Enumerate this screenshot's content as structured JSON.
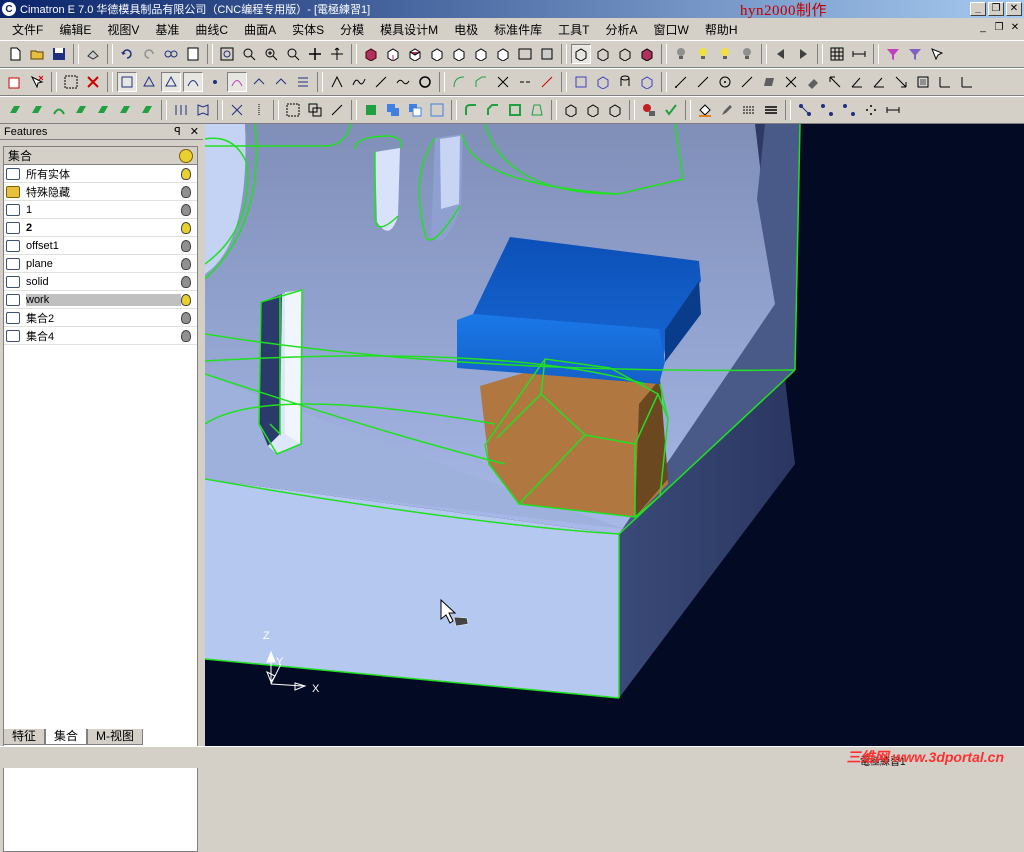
{
  "window": {
    "title": "Cimatron E 7.0  华德模具制品有限公司（CNC编程专用版）- [電極練習1]",
    "watermark": "hyn2000制作",
    "controls": [
      "_",
      "❐",
      "✕"
    ]
  },
  "menubar": {
    "items": [
      "文件F",
      "编辑E",
      "视图V",
      "基准",
      "曲线C",
      "曲面A",
      "实体S",
      "分模",
      "模具设计M",
      "电极",
      "标准件库",
      "工具T",
      "分析A",
      "窗口W",
      "帮助H"
    ],
    "mdi_controls": [
      "_",
      "❐",
      "✕"
    ]
  },
  "panel": {
    "title": "Features",
    "pin": "ꟼ",
    "close": "✕",
    "header": "集合",
    "rows": [
      {
        "label": "所有实体",
        "bulb": "#e8d030",
        "icon": "all"
      },
      {
        "label": "特殊隐藏",
        "bulb": "#909090",
        "icon": "folder"
      },
      {
        "label": "1",
        "bulb": "#909090",
        "icon": "set"
      },
      {
        "label": "2",
        "bulb": "#e8d030",
        "icon": "set",
        "bold": true
      },
      {
        "label": "offset1",
        "bulb": "#909090",
        "icon": "set"
      },
      {
        "label": "plane",
        "bulb": "#909090",
        "icon": "set"
      },
      {
        "label": "solid",
        "bulb": "#909090",
        "icon": "set"
      },
      {
        "label": "work",
        "bulb": "#e8d030",
        "icon": "set",
        "selected": true
      },
      {
        "label": "集合2",
        "bulb": "#909090",
        "icon": "set"
      },
      {
        "label": "集合4",
        "bulb": "#909090",
        "icon": "set"
      }
    ],
    "tabs": [
      "特征",
      "集合",
      "M-视图"
    ],
    "active_tab": "集合"
  },
  "viewport": {
    "axes": {
      "z": "Z",
      "y": "Y",
      "x": "X"
    },
    "colors": {
      "background": "#030a24",
      "edge": "#20e020",
      "block": "#b4c8f0",
      "electrode_top": "#1a6ad8",
      "electrode_body": "#b07840"
    }
  },
  "statusbar": {
    "watermark": "三维网 www.3dportal.cn",
    "text": "電極練習1"
  }
}
